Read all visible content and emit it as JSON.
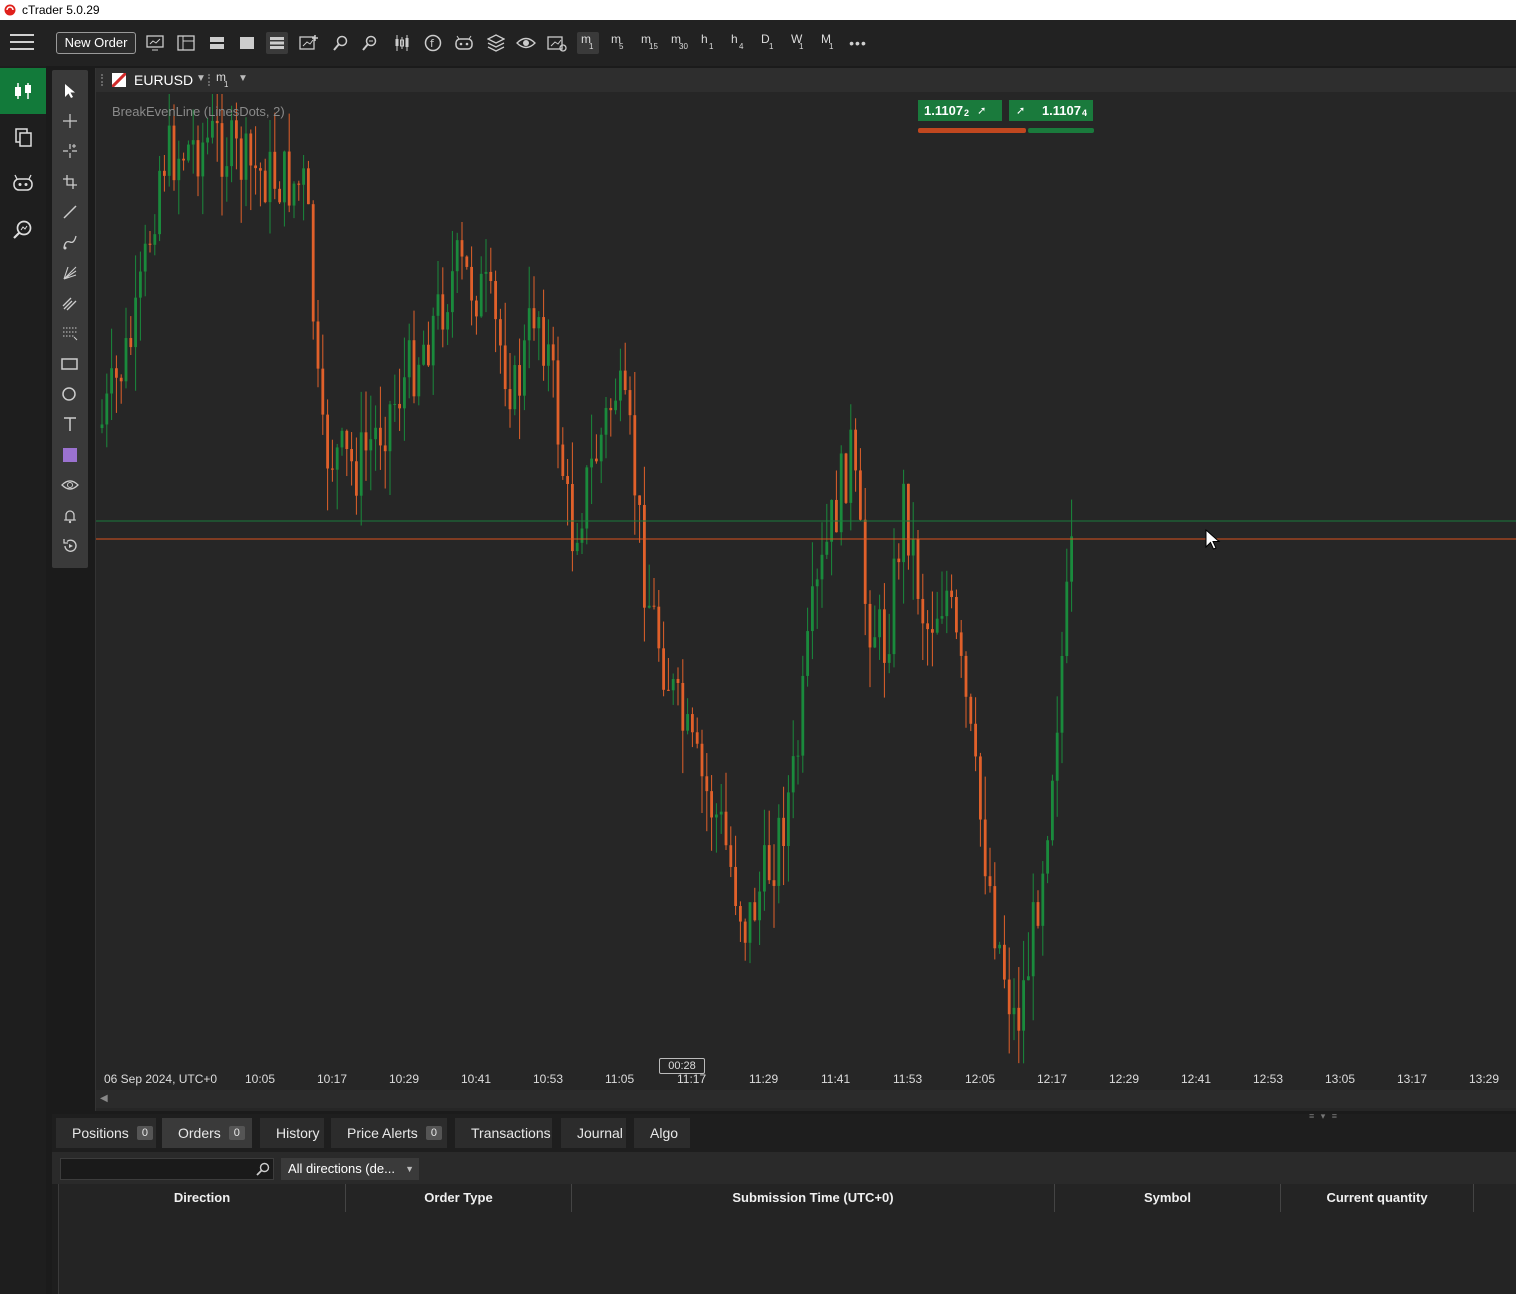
{
  "window": {
    "title": "cTrader 5.0.29"
  },
  "toolbar": {
    "new_order_label": "New Order",
    "timeframes": [
      {
        "main": "m",
        "sub": "1",
        "active": true
      },
      {
        "main": "m",
        "sub": "5"
      },
      {
        "main": "m",
        "sub": "15"
      },
      {
        "main": "m",
        "sub": "30"
      },
      {
        "main": "h",
        "sub": "1"
      },
      {
        "main": "h",
        "sub": "4"
      },
      {
        "main": "D",
        "sub": "1"
      },
      {
        "main": "W",
        "sub": "1"
      },
      {
        "main": "M",
        "sub": "1"
      }
    ],
    "more_label": "•••"
  },
  "chart": {
    "symbol": "EURUSD",
    "timeframe_main": "m",
    "timeframe_sub": "1",
    "indicator_label": "BreakEvenLine (LinesDots, 2)",
    "sell_price": "1.1107",
    "sell_price_digit": "2",
    "buy_price": "1.1107",
    "buy_price_digit": "4",
    "countdown": "00:28",
    "time_labels": [
      "06 Sep 2024, UTC+0",
      "10:05",
      "10:17",
      "10:29",
      "10:41",
      "10:53",
      "11:05",
      "11:17",
      "11:29",
      "11:41",
      "11:53",
      "12:05",
      "12:17",
      "12:29",
      "12:41",
      "12:53",
      "13:05",
      "13:17",
      "13:29"
    ],
    "colors": {
      "bull": "#1a8a3c",
      "bear": "#e0602a",
      "background": "#262626",
      "ask_line": "#1a7a3c",
      "bid_line": "#d9531e"
    }
  },
  "bottom_panel": {
    "tabs": [
      {
        "label": "Positions",
        "badge": "0"
      },
      {
        "label": "Orders",
        "badge": "0",
        "active": true
      },
      {
        "label": "History"
      },
      {
        "label": "Price Alerts",
        "badge": "0"
      },
      {
        "label": "Transactions"
      },
      {
        "label": "Journal"
      },
      {
        "label": "Algo"
      }
    ],
    "search_placeholder": "",
    "direction_filter": "All directions (de...",
    "columns": [
      "Direction",
      "Order Type",
      "Submission Time (UTC+0)",
      "Symbol",
      "Current quantity"
    ]
  }
}
